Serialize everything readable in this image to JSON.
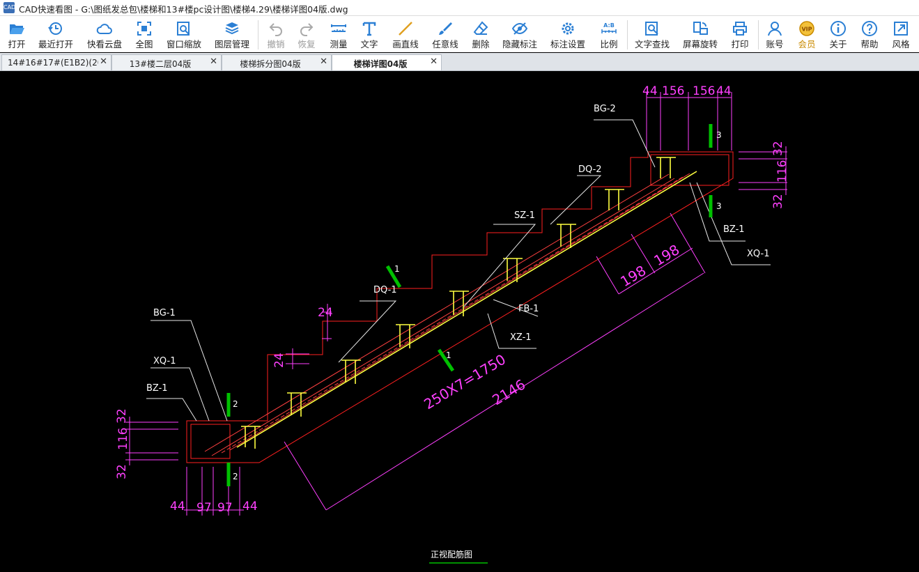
{
  "window": {
    "title": "CAD快速看图 - G:\\图纸发总包\\楼梯和13#楼pc设计图\\楼梯4.29\\楼梯详图04版.dwg",
    "app_icon_text": "CAD"
  },
  "toolbar": {
    "open": "打开",
    "recent": "最近打开",
    "cloud": "快看云盘",
    "full": "全图",
    "window_zoom": "窗口缩放",
    "layers": "图层管理",
    "undo": "撤销",
    "redo": "恢复",
    "measure": "测量",
    "text": "文字",
    "line": "画直线",
    "freehand": "任意线",
    "delete": "删除",
    "hide_marks": "隐藏标注",
    "mark_settings": "标注设置",
    "scale": "比例",
    "text_search": "文字查找",
    "rotate": "屏幕旋转",
    "print": "打印",
    "account": "账号",
    "vip": "会员",
    "about": "关于",
    "help": "帮助",
    "style": "风格",
    "scale_icon_text": "A:B"
  },
  "tabs": [
    {
      "label": "14#16#17#(E1B2)(20⋯"
    },
    {
      "label": "13#楼二层04版"
    },
    {
      "label": "楼梯拆分图04版"
    },
    {
      "label": "楼梯详图04版"
    }
  ],
  "tab_close": "✕",
  "drawing": {
    "labels": {
      "bg2": "BG-2",
      "dq2": "DQ-2",
      "sz1": "SZ-1",
      "dq1": "DQ-1",
      "fb1": "FB-1",
      "xz1": "XZ-1",
      "bz1_right": "BZ-1",
      "xq1_right": "XQ-1",
      "bg1": "BG-1",
      "xq1_left": "XQ-1",
      "bz1_left": "BZ-1"
    },
    "dims": {
      "top_a": "44",
      "top_b": "156",
      "top_c": "156",
      "top_d": "44",
      "right_32a": "32",
      "right_116": "116",
      "right_32b": "32",
      "left_32a": "32",
      "left_116": "116",
      "left_32b": "32",
      "bottom_a": "44",
      "bottom_b": "97",
      "bottom_c": "97",
      "bottom_d": "44",
      "riser_24a": "24",
      "riser_24b": "24",
      "span_198a": "198",
      "span_198b": "198",
      "tread_total": "250X7=1750",
      "total_length": "2146"
    },
    "section_marks": {
      "s1_top": "1",
      "s1_bottom": "1",
      "s2_top": "2",
      "s2_bottom": "2",
      "s3_top": "3",
      "s3_bottom": "3"
    },
    "caption": "正视配筋图",
    "colors": {
      "background": "#000000",
      "outline": "#ff2020",
      "rebar": "#ffff40",
      "dimension": "#ff40ff",
      "leader": "#ffffff",
      "section": "#00c000",
      "text": "#ffffff"
    }
  }
}
